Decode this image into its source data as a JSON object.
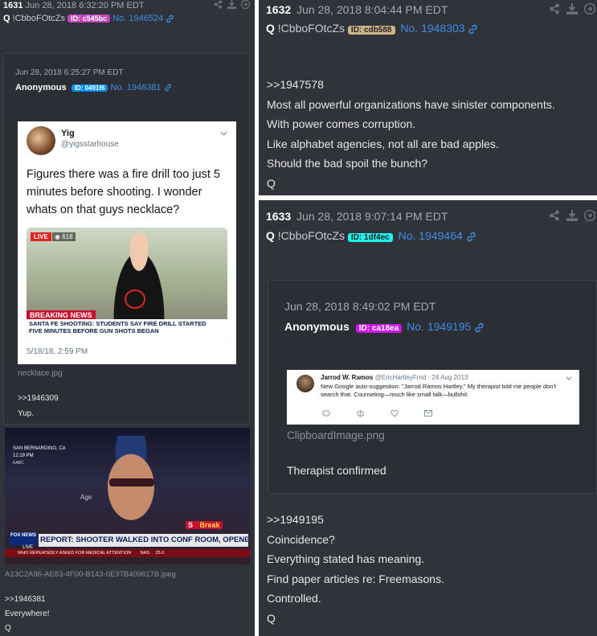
{
  "left_panel": {
    "number": "1631",
    "date": "Jun 28, 2018 6:32:20 PM EDT",
    "q": "Q",
    "tripcode": "!CbboFOtcZs",
    "id_badge": "ID: c545bc",
    "post_no": "No. 1946524",
    "quoted": {
      "date": "Jun 28, 2018 6:25:27 PM EDT",
      "author": "Anonymous",
      "id_badge": "ID: 0491f6",
      "post_no": "No. 1946381",
      "tweet": {
        "name": "Yig",
        "handle": "@yigsstarhouse",
        "text": "Figures there was a fire drill too just 5 minutes before shooting. I wonder whats on that guys necklace?",
        "live": "LIVE",
        "viewers": "618",
        "breaking": "BREAKING NEWS",
        "headline_1": "SANTA FE SHOOTING: STUDENTS SAY FIRE DRILL STARTED",
        "headline_2": "FIVE MINUTES BEFORE GUN SHOTS BEGAN",
        "timestamp": "5/18/18, 2:59 PM"
      },
      "filename": "necklace.jpg",
      "reply_ref": ">>1946309",
      "reply_text": "Yup."
    },
    "tv": {
      "location": "SAN BERNARDINO, CA",
      "time": "12:19 PM",
      "station": "KABC",
      "headline": "REPORT: SHOOTER WALKED INTO CONF ROOM, OPENED FIRE",
      "ticker": "WHO REPEATEDLY ASKED FOR MEDICAL ATTENTION",
      "ticker_right": "NAS",
      "ticker_val": "25.0",
      "fox": "FOX NEWS",
      "live": "LIVE",
      "breaking": "Break",
      "alert": "S",
      "age": "Age"
    },
    "filename2": "A13C2A96-AE83-4F00-B143-0E37B409617B.jpeg",
    "ref2": ">>1946381",
    "line1": "Everywhere!",
    "sign": "Q"
  },
  "right_top": {
    "number": "1632",
    "date": "Jun 28, 2018 8:04:44 PM EDT",
    "q": "Q",
    "tripcode": "!CbboFOtcZs",
    "id_badge": "ID: cdb588",
    "post_no": "No. 1948303",
    "lines": [
      ">>1947578",
      "Most all powerful organizations have sinister components.",
      "With power comes corruption.",
      "Like alphabet agencies, not all are bad apples.",
      "Should the bad spoil the bunch?",
      "Q"
    ]
  },
  "right_bottom": {
    "number": "1633",
    "date": "Jun 28, 2018 9:07:14 PM EDT",
    "q": "Q",
    "tripcode": "!CbboFOtcZs",
    "id_badge": "ID: 1df4ec",
    "post_no": "No. 1949464",
    "quoted": {
      "date": "Jun 28, 2018 8:49:02 PM EDT",
      "author": "Anonymous",
      "id_badge": "ID: ca18ea",
      "post_no": "No. 1949195",
      "tweet": {
        "name": "Jarrod W. Ramos",
        "handle": "@EricHartleyFrnd",
        "date": "· 24 Aug 2013",
        "text": "New Google auto-suggestion: \"Jarrod Ramos Hartley.\" My therapist told me people don't search that. Counseling—much like small talk—bullshit."
      },
      "filename": "ClipboardImage.png",
      "text": "Therapist confirmed"
    },
    "lines": [
      ">>1949195",
      "Coincidence?",
      "Everything stated has meaning.",
      "Find paper articles re: Freemasons.",
      "Controlled.",
      "Q"
    ]
  },
  "colors": {
    "panel_bg": "#30333a",
    "post_link": "#3f8de6",
    "badge_c545bc": "#c545bc",
    "badge_0491f6": "#0491f6",
    "badge_cdb588": "#cdb588",
    "badge_1df4ec": "#1df4ec",
    "badge_ca18ea": "#ca18ea"
  }
}
